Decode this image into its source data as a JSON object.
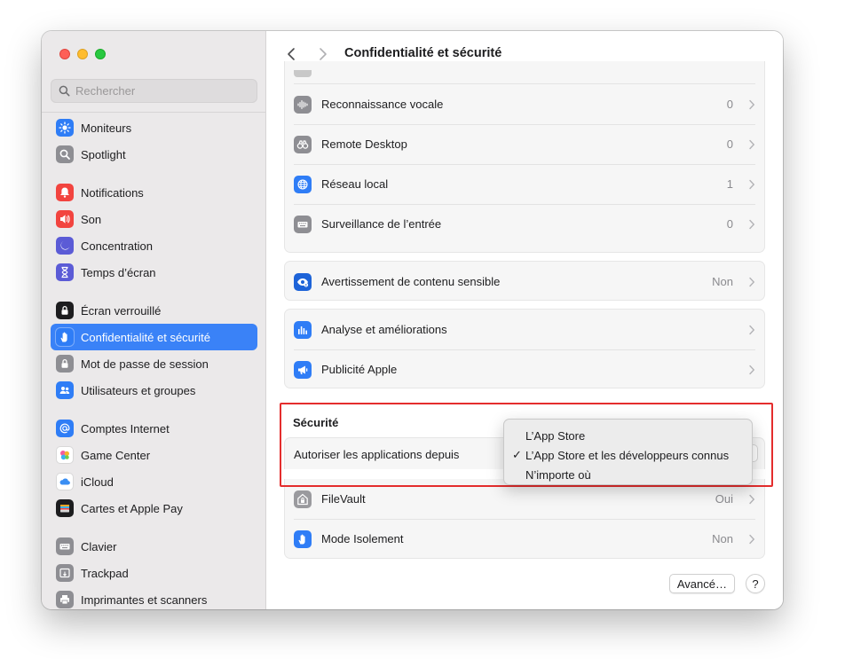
{
  "window": {
    "title": "Confidentialité et sécurité"
  },
  "search": {
    "placeholder": "Rechercher"
  },
  "sidebar": {
    "items": [
      {
        "label": "Moniteurs",
        "icon": "display-icon",
        "color": "#2f7df6"
      },
      {
        "label": "Spotlight",
        "icon": "magnifier-icon",
        "color": "#8e8e93"
      },
      {
        "label": "Notifications",
        "icon": "bell-icon",
        "color": "#f2443f"
      },
      {
        "label": "Son",
        "icon": "speaker-icon",
        "color": "#f2443f"
      },
      {
        "label": "Concentration",
        "icon": "moon-icon",
        "color": "#5b5bd6"
      },
      {
        "label": "Temps d’écran",
        "icon": "hourglass-icon",
        "color": "#5b5bd6"
      },
      {
        "label": "Écran verrouillé",
        "icon": "lock-icon",
        "color": "#1d1d1f"
      },
      {
        "label": "Confidentialité et sécurité",
        "icon": "hand-icon",
        "color": "#2f7df6"
      },
      {
        "label": "Mot de passe de session",
        "icon": "padlock-icon",
        "color": "#8e8e93"
      },
      {
        "label": "Utilisateurs et groupes",
        "icon": "users-icon",
        "color": "#2f7df6"
      },
      {
        "label": "Comptes Internet",
        "icon": "at-icon",
        "color": "#2f7df6"
      },
      {
        "label": "Game Center",
        "icon": "game-center-icon",
        "color": "#ffffff"
      },
      {
        "label": "iCloud",
        "icon": "cloud-icon",
        "color": "#ffffff"
      },
      {
        "label": "Cartes et Apple Pay",
        "icon": "wallet-icon",
        "color": "#1d1d1f"
      },
      {
        "label": "Clavier",
        "icon": "keyboard-icon",
        "color": "#8e8e93"
      },
      {
        "label": "Trackpad",
        "icon": "trackpad-icon",
        "color": "#8e8e93"
      },
      {
        "label": "Imprimantes et scanners",
        "icon": "printer-icon",
        "color": "#8e8e93"
      }
    ]
  },
  "main": {
    "privacy_rows": [
      {
        "label": "Reconnaissance vocale",
        "value": "0",
        "icon": "waveform-icon"
      },
      {
        "label": "Remote Desktop",
        "value": "0",
        "icon": "binoculars-icon"
      },
      {
        "label": "Réseau local",
        "value": "1",
        "icon": "globe-icon"
      },
      {
        "label": "Surveillance de l’entrée",
        "value": "0",
        "icon": "keyboard-input-icon"
      }
    ],
    "sensitive_row": {
      "label": "Avertissement de contenu sensible",
      "value": "Non",
      "icon": "eye-icon"
    },
    "analytics_rows": [
      {
        "label": "Analyse et améliorations",
        "value": "",
        "icon": "chart-icon"
      },
      {
        "label": "Publicité Apple",
        "value": "",
        "icon": "megaphone-icon"
      }
    ],
    "security": {
      "title": "Sécurité",
      "allow_label": "Autoriser les applications depuis",
      "popup_options": [
        {
          "label": "L’App Store",
          "checked": false
        },
        {
          "label": "L’App Store et les développeurs connus",
          "checked": true
        },
        {
          "label": "N’importe où",
          "checked": false
        }
      ],
      "check_mark": "✓"
    },
    "security_rows": [
      {
        "label": "FileVault",
        "value": "Oui",
        "icon": "house-lock-icon"
      },
      {
        "label": "Mode Isolement",
        "value": "Non",
        "icon": "hand-icon"
      }
    ],
    "buttons": {
      "advanced": "Avancé…",
      "help": "?"
    }
  },
  "colors": {
    "accent": "#3a82f7",
    "highlight": "#e42d2d"
  }
}
